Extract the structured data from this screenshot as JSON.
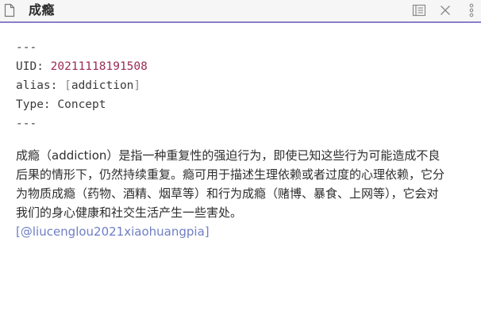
{
  "titlebar": {
    "title": "成瘾",
    "icons": {
      "file": "file-icon",
      "reading_view": "reading-view-icon",
      "close": "close-icon",
      "more": "more-options-icon"
    },
    "accent_color": "#8b7fc7"
  },
  "frontmatter": {
    "delimiter_open": "---",
    "uid_key": "UID: ",
    "uid_value": "20211118191508",
    "alias_key": "alias: ",
    "alias_open": "[",
    "alias_value": "addiction",
    "alias_close": "]",
    "type_key": "Type: ",
    "type_value": "Concept",
    "delimiter_close": "---"
  },
  "body": {
    "paragraph": "成瘾（addiction）是指一种重复性的强迫行为，即使已知这些行为可能造成不良后果的情形下，仍然持续重复。瘾可用于描述生理依赖或者过度的心理依赖，它分为物质成瘾（药物、酒精、烟草等）和行为成瘾（赌博、暴食、上网等），它会对我们的身心健康和社交生活产生一些害处。",
    "citation_open": "[",
    "citation_text": "@liucenglou2021xiaohuangpia",
    "citation_close": "]"
  }
}
